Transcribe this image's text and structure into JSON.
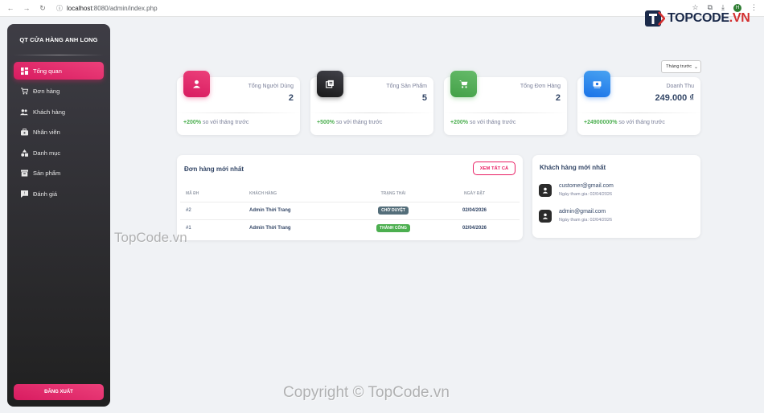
{
  "browser": {
    "url_host": "localhost",
    "url_path": ":8080/admin/index.php",
    "profile_initial": "H"
  },
  "sidebar": {
    "brand": "QT CỬA HÀNG ANH LONG",
    "items": [
      {
        "label": "Tổng quan",
        "icon": "dashboard-icon",
        "active": true
      },
      {
        "label": "Đơn hàng",
        "icon": "cart-icon"
      },
      {
        "label": "Khách hàng",
        "icon": "users-icon"
      },
      {
        "label": "Nhân viên",
        "icon": "briefcase-icon"
      },
      {
        "label": "Danh mục",
        "icon": "category-icon"
      },
      {
        "label": "Sản phẩm",
        "icon": "box-icon"
      },
      {
        "label": "Đánh giá",
        "icon": "review-icon"
      }
    ],
    "logout_label": "ĐĂNG XUẤT"
  },
  "filter": {
    "month_select_value": "Tháng trước"
  },
  "stats": [
    {
      "label": "Tổng Người Dùng",
      "value": "2",
      "change": "+200%",
      "suffix": "so với tháng trước",
      "icon": "user-icon",
      "color": "#e91e63"
    },
    {
      "label": "Tổng Sản Phẩm",
      "value": "5",
      "change": "+500%",
      "suffix": "so với tháng trước",
      "icon": "products-icon",
      "color": "#2f2f33"
    },
    {
      "label": "Tổng Đơn Hàng",
      "value": "2",
      "change": "+200%",
      "suffix": "so với tháng trước",
      "icon": "cart-icon",
      "color": "#4caf50"
    },
    {
      "label": "Doanh Thu",
      "value": "249.000 ₫",
      "change": "+24900000%",
      "suffix": "so với tháng trước",
      "icon": "money-icon",
      "color": "#1e88e5"
    }
  ],
  "orders": {
    "title": "Đơn hàng mới nhất",
    "view_all_label": "XEM TẤT CẢ",
    "columns": [
      "MÃ ĐH",
      "KHÁCH HÀNG",
      "TRẠNG THÁI",
      "NGÀY ĐẶT"
    ],
    "rows": [
      {
        "id": "#2",
        "customer": "Admin Thời Trang",
        "status": "CHỜ DUYỆT",
        "status_color": "#546e7a",
        "date": "02/04/2026"
      },
      {
        "id": "#1",
        "customer": "Admin Thời Trang",
        "status": "THÀNH CÔNG",
        "status_color": "#4caf50",
        "date": "02/04/2026"
      }
    ]
  },
  "customers": {
    "title": "Khách hàng mới nhất",
    "items": [
      {
        "email": "customer@gmail.com",
        "joined": "Ngày tham gia: 02/04/2026"
      },
      {
        "email": "admin@gmail.com",
        "joined": "Ngày tham gia: 02/04/2026"
      }
    ]
  },
  "watermarks": {
    "logo_text_a": "TOPCODE",
    "logo_text_b": ".VN",
    "middle": "TopCode.vn",
    "bottom": "Copyright © TopCode.vn"
  }
}
